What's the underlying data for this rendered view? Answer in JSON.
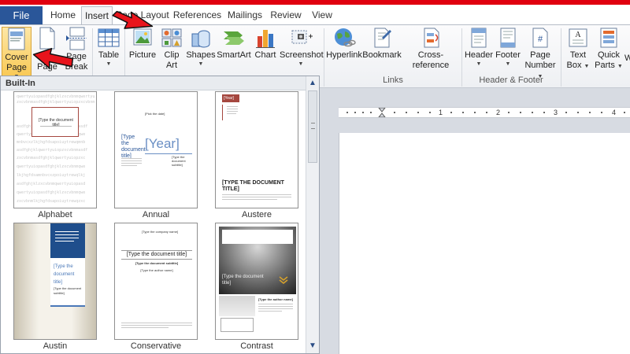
{
  "tabs": {
    "file": "File",
    "home": "Home",
    "insert": "Insert",
    "page_layout": "Page Layout",
    "references": "References",
    "mailings": "Mailings",
    "review": "Review",
    "view": "View"
  },
  "ribbon": {
    "cover_page": {
      "line1": "Cover",
      "line2": "Page"
    },
    "blank_page": {
      "line1": "B",
      "line2": "Page"
    },
    "page_break": {
      "line1": "Page",
      "line2": "Break"
    },
    "table": "Table",
    "picture": "Picture",
    "clip_art": {
      "line1": "Clip",
      "line2": "Art"
    },
    "shapes": "Shapes",
    "smartart": "SmartArt",
    "chart": "Chart",
    "screenshot": "Screenshot",
    "hyperlink": "Hyperlink",
    "bookmark": "Bookmark",
    "cross_reference": "Cross-reference",
    "links_group": "Links",
    "header": "Header",
    "footer": "Footer",
    "page_number": {
      "line1": "Page",
      "line2": "Number"
    },
    "header_footer_group": "Header & Footer",
    "text_box": {
      "line1": "Text",
      "line2": "Box"
    },
    "quick_parts": {
      "line1": "Quick",
      "line2": "Parts"
    },
    "partial_next": "W"
  },
  "gallery": {
    "heading": "Built-In",
    "items": [
      {
        "name": "Alphabet"
      },
      {
        "name": "Annual"
      },
      {
        "name": "Austere"
      },
      {
        "name": "Austin"
      },
      {
        "name": "Conservative"
      },
      {
        "name": "Contrast"
      }
    ],
    "thumbs": {
      "alphabet_title": "[Type the document title]",
      "annual_date": "[Pick the date]",
      "annual_title": "[Type the document title]",
      "annual_year": "[Year]",
      "annual_subtitle": "[Type the document subtitle]",
      "austere_year": "[Year]",
      "austere_title": "[TYPE THE DOCUMENT TITLE]",
      "austin_title": "[Type the document title]",
      "austin_subtitle": "[Type the document subtitle]",
      "conservative_company": "[Type the company name]",
      "conservative_title": "[Type the document title]",
      "conservative_subtitle": "[Type the document subtitle]",
      "conservative_author": "[Type the author name]",
      "contrast_title": "[Type the document title]",
      "contrast_author": "[Type the author name]"
    }
  },
  "ruler": {
    "n1": "1",
    "n2": "2",
    "n3": "3",
    "n4": "4"
  },
  "colors": {
    "file_tab": "#2a5699",
    "red_strip": "#e0000f",
    "pressed_button": "#f9c955",
    "annotation_arrow": "#e8141c"
  },
  "icons": [
    "cover-page-icon",
    "blank-page-icon",
    "page-break-icon",
    "table-icon",
    "picture-icon",
    "clip-art-icon",
    "shapes-icon",
    "smartart-icon",
    "chart-icon",
    "screenshot-icon",
    "hyperlink-icon",
    "bookmark-icon",
    "cross-reference-icon",
    "header-icon",
    "footer-icon",
    "page-number-icon",
    "text-box-icon",
    "quick-parts-icon"
  ]
}
